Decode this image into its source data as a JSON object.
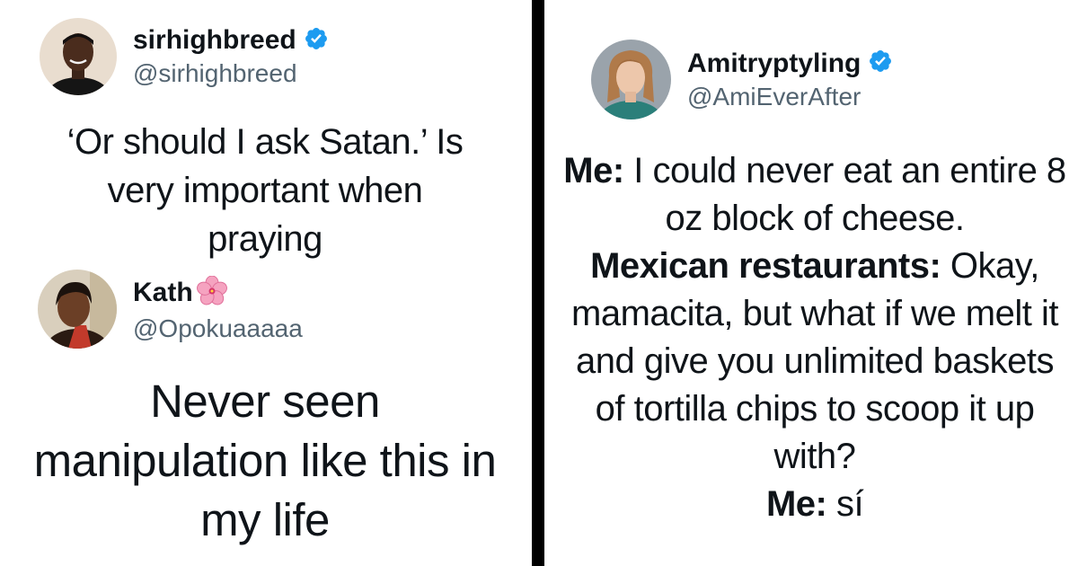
{
  "tweets": [
    {
      "display_name": "sirhighbreed",
      "handle": "@sirhighbreed",
      "verified": true,
      "text": "‘Or should I ask Satan.’ Is very important when praying"
    },
    {
      "display_name": "Kath",
      "handle": "@Opokuaaaaa",
      "verified": false,
      "emoji_icon": "hibiscus-flower-icon",
      "text": "Never seen manipulation like this in my life"
    },
    {
      "display_name": "Amitryptyling",
      "handle": "@AmiEverAfter",
      "verified": true,
      "lines": [
        {
          "speaker": "Me:",
          "text": " I could never eat an entire 8 oz block of cheese."
        },
        {
          "speaker": "Mexican restaurants:",
          "text": " Okay, mamacita, but what if we melt it and give you unlimited baskets of tortilla chips to scoop it up with?"
        },
        {
          "speaker": "Me:",
          "text": " sí"
        }
      ]
    }
  ],
  "colors": {
    "text": "#0f1419",
    "handle": "#536471",
    "verified_badge": "#1d9bf0",
    "divider": "#000000",
    "background": "#ffffff"
  }
}
